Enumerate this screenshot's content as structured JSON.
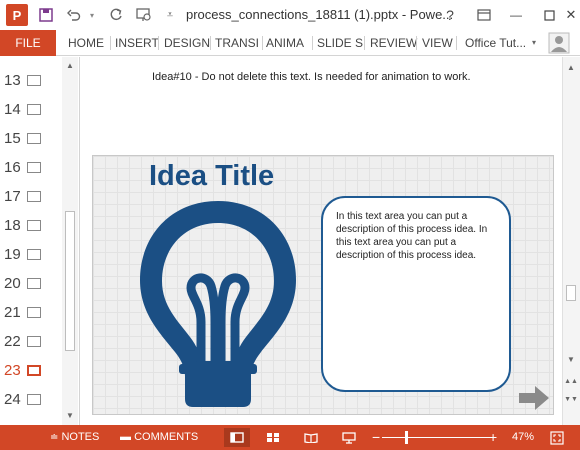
{
  "window": {
    "app_letter": "P",
    "doc_title": "process_connections_18811 (1).pptx - Powe...",
    "help_label": "?",
    "min_label": "—",
    "close_label": "✕"
  },
  "ribbon": {
    "file": "FILE",
    "tabs": [
      "HOME",
      "INSERT",
      "DESIGN",
      "TRANSI",
      "ANIMA",
      "SLIDE S",
      "REVIEW",
      "VIEW",
      "Office Tut..."
    ]
  },
  "thumbnails": [
    {
      "num": "13",
      "icon": "slide-thumb-icon"
    },
    {
      "num": "14",
      "icon": "slide-thumb-icon"
    },
    {
      "num": "15",
      "icon": "slide-thumb-icon"
    },
    {
      "num": "16",
      "icon": "slide-thumb-icon"
    },
    {
      "num": "17",
      "icon": "slide-thumb-icon"
    },
    {
      "num": "18",
      "icon": "slide-thumb-icon"
    },
    {
      "num": "19",
      "icon": "slide-thumb-icon"
    },
    {
      "num": "20",
      "icon": "slide-thumb-icon"
    },
    {
      "num": "21",
      "icon": "slide-thumb-icon"
    },
    {
      "num": "22",
      "icon": "slide-thumb-icon"
    },
    {
      "num": "23",
      "icon": "slide-thumb-icon",
      "active": true
    },
    {
      "num": "24",
      "icon": "slide-thumb-icon"
    }
  ],
  "editor": {
    "note": "Idea#10 -  Do not delete this text.  Is needed for animation to work."
  },
  "slide": {
    "title": "Idea Title",
    "description": "In this text area you can put a description of this process idea. In this text area you can put a description of this process idea.",
    "accent_color": "#1b4f84",
    "bulb_icon": "lightbulb-icon"
  },
  "status": {
    "notes": "NOTES",
    "comments": "COMMENTS",
    "zoom_minus": "−",
    "zoom_plus": "+",
    "zoom": "47%",
    "zoom_level_fraction": 0.47,
    "accent_color": "#d24726"
  }
}
